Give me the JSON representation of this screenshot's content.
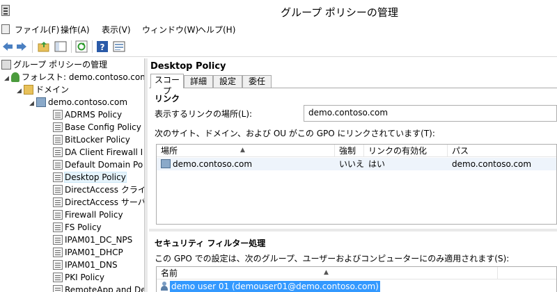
{
  "window": {
    "title": "グループ ポリシーの管理"
  },
  "menu": [
    "ファイル(F)",
    "操作(A)",
    "表示(V)",
    "ウィンドウ(W)",
    "ヘルプ(H)"
  ],
  "tree": {
    "root": "グループ ポリシーの管理",
    "forest": "フォレスト: demo.contoso.com",
    "domains": "ドメイン",
    "domain": "demo.contoso.com",
    "gpos": [
      "ADRMS Policy",
      "Base Config Policy",
      "BitLocker Policy",
      "DA Client Firewall I",
      "Default Domain Po",
      "Desktop Policy",
      "DirectAccess クライア",
      "DirectAccess サーバ",
      "Firewall Policy",
      "FS Policy",
      "IPAM01_DC_NPS",
      "IPAM01_DHCP",
      "IPAM01_DNS",
      "PKI Policy",
      "RemoteApp and De"
    ],
    "selected_index": 5
  },
  "detail": {
    "title": "Desktop Policy",
    "tabs": [
      "スコープ",
      "詳細",
      "設定",
      "委任"
    ],
    "links": {
      "heading": "リンク",
      "location_label": "表示するリンクの場所(L):",
      "location_value": "demo.contoso.com",
      "description": "次のサイト、ドメイン、および OU がこの GPO にリンクされています(T):",
      "columns": [
        "場所",
        "強制",
        "リンクの有効化",
        "パス"
      ],
      "rows": [
        {
          "location": "demo.contoso.com",
          "enforced": "いいえ",
          "enabled": "はい",
          "path": "demo.contoso.com"
        }
      ]
    },
    "security": {
      "heading": "セキュリティ フィルター処理",
      "description": "この GPO での設定は、次のグループ、ユーザーおよびコンピューターにのみ適用されます(S):",
      "column": "名前",
      "rows": [
        "demo user 01 (demouser01@demo.contoso.com)"
      ]
    }
  }
}
